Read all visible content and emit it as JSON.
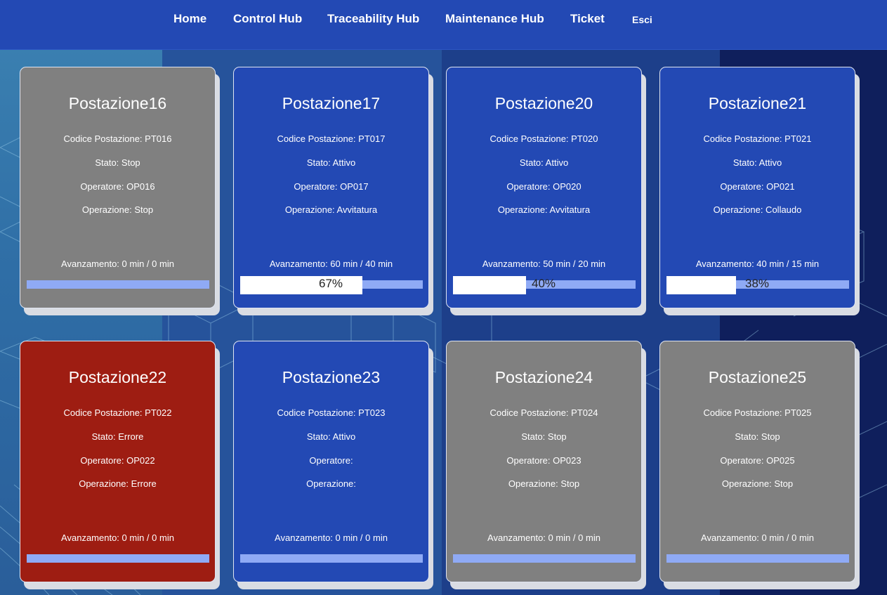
{
  "nav": {
    "items": [
      "Home",
      "Control Hub",
      "Traceability Hub",
      "Maintenance Hub",
      "Ticket"
    ],
    "logout": "Esci"
  },
  "labels": {
    "code": "Codice Postazione:",
    "state": "Stato:",
    "operator": "Operatore:",
    "operation": "Operazione:",
    "progress": "Avanzamento:"
  },
  "colors": {
    "blue": "#2349b4",
    "gray": "#808080",
    "red": "#9e1d12",
    "progress_track": "#8faaf5"
  },
  "cards": [
    {
      "title": "Postazione16",
      "code": "Codice Postazione: PT016",
      "state": "Stato: Stop",
      "operator": "Operatore: OP016",
      "operation": "Operazione: Stop",
      "progress_text": "Avanzamento: 0 min / 0 min",
      "percent": null,
      "color": "gray"
    },
    {
      "title": "Postazione17",
      "code": "Codice Postazione: PT017",
      "state": "Stato: Attivo",
      "operator": "Operatore: OP017",
      "operation": "Operazione: Avvitatura",
      "progress_text": "Avanzamento: 60 min / 40 min",
      "percent": 67,
      "percent_label": "67%",
      "color": "blue"
    },
    {
      "title": "Postazione20",
      "code": "Codice Postazione: PT020",
      "state": "Stato: Attivo",
      "operator": "Operatore: OP020",
      "operation": "Operazione: Avvitatura",
      "progress_text": "Avanzamento: 50 min / 20 min",
      "percent": 40,
      "percent_label": "40%",
      "color": "blue"
    },
    {
      "title": "Postazione21",
      "code": "Codice Postazione: PT021",
      "state": "Stato: Attivo",
      "operator": "Operatore: OP021",
      "operation": "Operazione: Collaudo",
      "progress_text": "Avanzamento: 40 min / 15 min",
      "percent": 38,
      "percent_label": "38%",
      "color": "blue"
    },
    {
      "title": "Postazione22",
      "code": "Codice Postazione: PT022",
      "state": "Stato: Errore",
      "operator": "Operatore: OP022",
      "operation": "Operazione: Errore",
      "progress_text": "Avanzamento: 0 min / 0 min",
      "percent": null,
      "color": "red"
    },
    {
      "title": "Postazione23",
      "code": "Codice Postazione: PT023",
      "state": "Stato: Attivo",
      "operator": "Operatore:",
      "operation": "Operazione:",
      "progress_text": "Avanzamento: 0 min / 0 min",
      "percent": null,
      "color": "blue"
    },
    {
      "title": "Postazione24",
      "code": "Codice Postazione: PT024",
      "state": "Stato: Stop",
      "operator": "Operatore: OP023",
      "operation": "Operazione: Stop",
      "progress_text": "Avanzamento: 0 min / 0 min",
      "percent": null,
      "color": "gray"
    },
    {
      "title": "Postazione25",
      "code": "Codice Postazione: PT025",
      "state": "Stato: Stop",
      "operator": "Operatore: OP025",
      "operation": "Operazione: Stop",
      "progress_text": "Avanzamento: 0 min / 0 min",
      "percent": null,
      "color": "gray"
    }
  ]
}
